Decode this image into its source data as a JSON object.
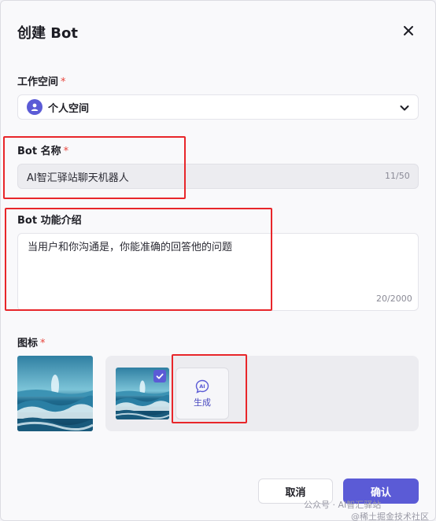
{
  "dialog": {
    "title": "创建 Bot"
  },
  "workspace": {
    "label": "工作空间",
    "required": "*",
    "selected": "个人空间"
  },
  "bot_name": {
    "label": "Bot 名称",
    "required": "*",
    "value": "AI智汇驿站聊天机器人",
    "counter": "11/50"
  },
  "bot_intro": {
    "label": "Bot 功能介绍",
    "value": "当用户和你沟通是，你能准确的回答他的问题",
    "counter": "20/2000"
  },
  "icon": {
    "label": "图标",
    "required": "*",
    "generate_label": "生成",
    "generate_badge": "AI"
  },
  "footer": {
    "cancel_label": "取消",
    "confirm_label": "确认"
  },
  "watermark": {
    "line1": "公众号 · AI智汇驿站",
    "line2": "@稀土掘金技术社区"
  },
  "colors": {
    "accent": "#5b5bd6",
    "required": "#e8453c",
    "highlight": "#e8262a"
  }
}
